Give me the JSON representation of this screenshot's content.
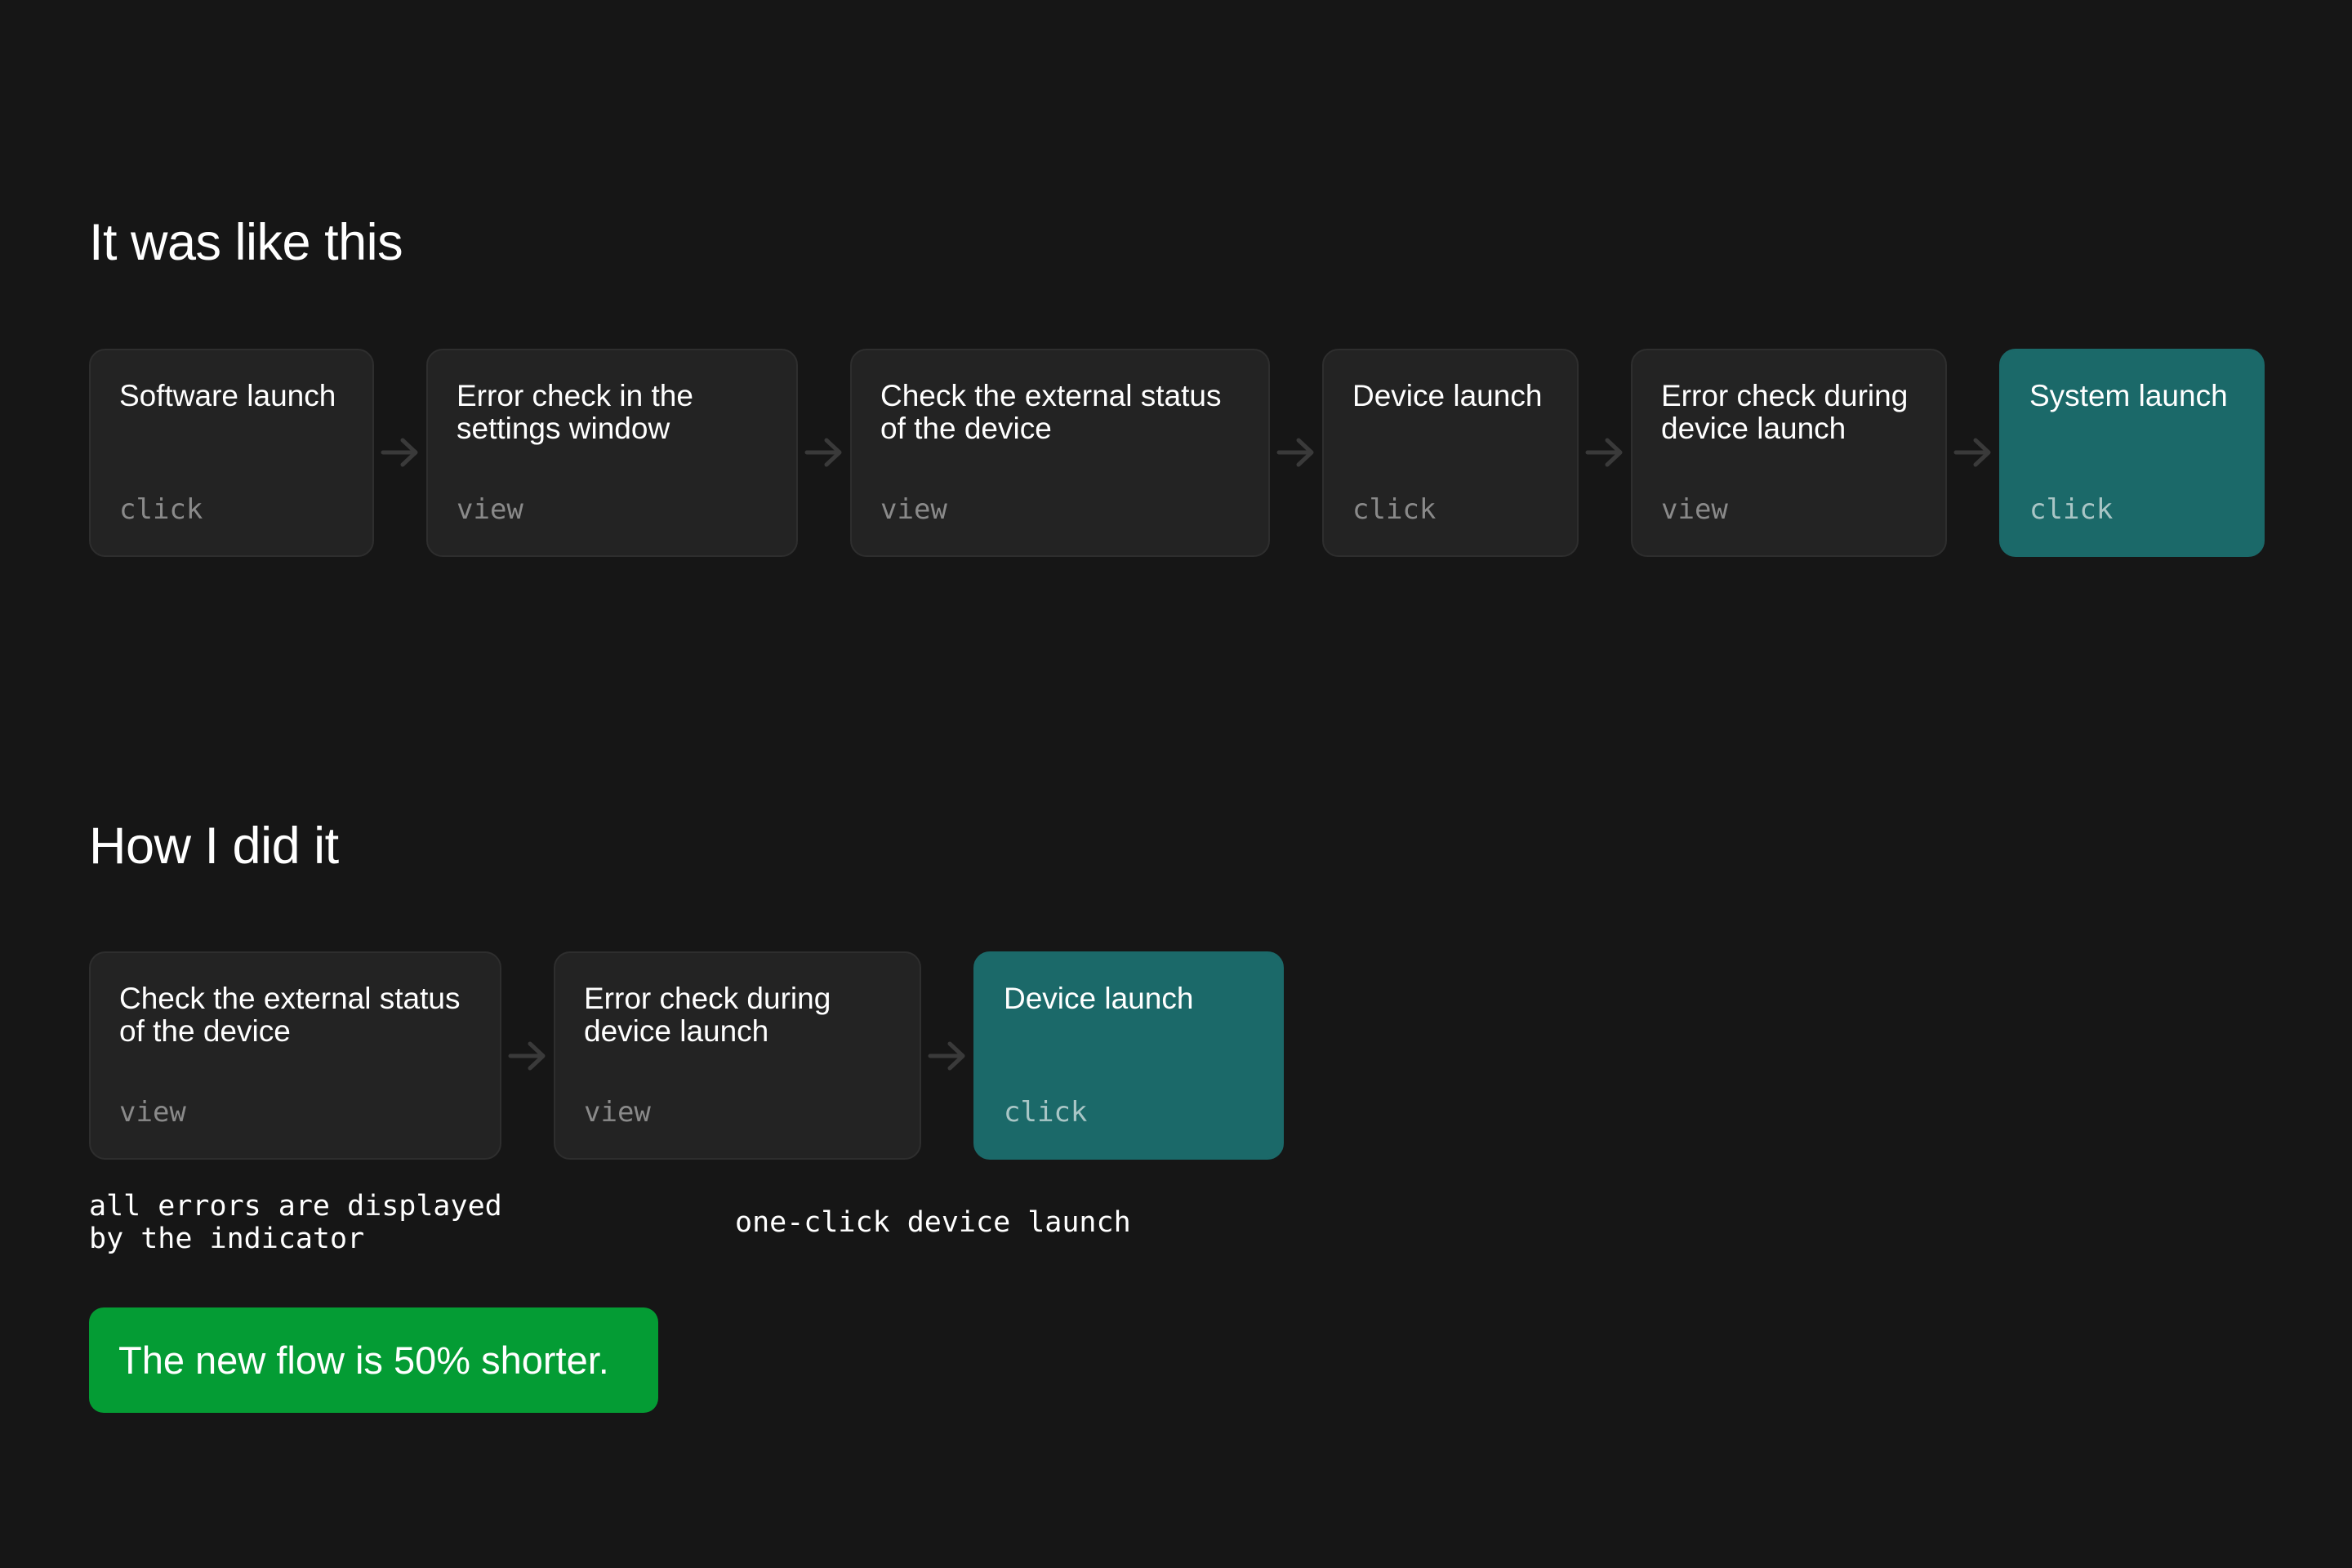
{
  "before": {
    "title": "It was like this",
    "steps": [
      {
        "title": "Software launch",
        "action": "click"
      },
      {
        "title": "Error check in the\nsettings window",
        "action": "view"
      },
      {
        "title": "Check the external status\nof the device",
        "action": "view"
      },
      {
        "title": "Device launch",
        "action": "click"
      },
      {
        "title": "Error check during\ndevice launch",
        "action": "view"
      },
      {
        "title": "System launch",
        "action": "click",
        "highlight": true
      }
    ]
  },
  "after": {
    "title": "How I did it",
    "steps": [
      {
        "title": "Check the external status\nof the device",
        "action": "view"
      },
      {
        "title": "Error check during\ndevice launch",
        "action": "view"
      },
      {
        "title": "Device launch",
        "action": "click",
        "highlight": true
      }
    ],
    "notes": {
      "errors": "all errors are displayed\nby the indicator",
      "launch": "one-click device launch"
    }
  },
  "summary": "The new flow is 50% shorter.",
  "colors": {
    "background": "#161616",
    "card": "#232323",
    "card_border": "#2e2e2e",
    "highlight": "#1b6969",
    "callout": "#049c34",
    "arrow": "#3a3a3a"
  }
}
